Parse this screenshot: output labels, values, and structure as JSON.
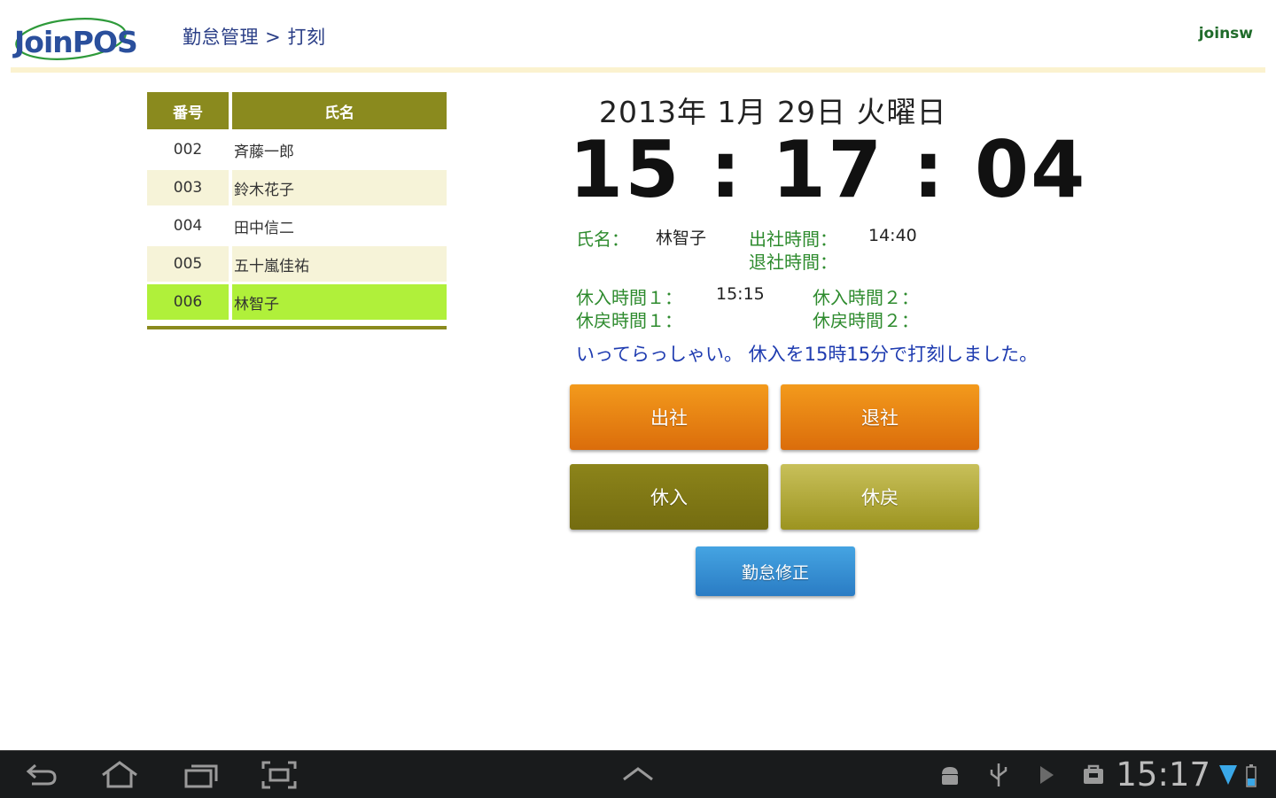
{
  "header": {
    "logo_text": "JoinPOS",
    "breadcrumb": "勤怠管理 > 打刻",
    "user": "joinsw"
  },
  "employee_table": {
    "columns": [
      "番号",
      "氏名"
    ],
    "rows": [
      {
        "id": "002",
        "name": "斉藤一郎"
      },
      {
        "id": "003",
        "name": "鈴木花子"
      },
      {
        "id": "004",
        "name": "田中信二"
      },
      {
        "id": "005",
        "name": "五十嵐佳祐"
      },
      {
        "id": "006",
        "name": "林智子",
        "selected": true
      }
    ]
  },
  "clock": {
    "date": "2013年 1月 29日 火曜日",
    "time": "15 : 17 : 04"
  },
  "detail": {
    "name_label": "氏名：",
    "name_value": "林智子",
    "clock_in_label": "出社時間：",
    "clock_in_value": "14:40",
    "clock_out_label": "退社時間：",
    "clock_out_value": "",
    "break_in1_label": "休入時間１：",
    "break_in1_value": "15:15",
    "break_out1_label": "休戻時間１：",
    "break_out1_value": "",
    "break_in2_label": "休入時間２：",
    "break_in2_value": "",
    "break_out2_label": "休戻時間２：",
    "break_out2_value": ""
  },
  "message": "いってらっしゃい。 休入を15時15分で打刻しました。",
  "buttons": {
    "clock_in": "出社",
    "clock_out": "退社",
    "break_in": "休入",
    "break_return": "休戻",
    "attendance_fix": "勤怠修正"
  },
  "system_bar": {
    "time": "15:17"
  },
  "colors": {
    "table_header": "#8a8a1e",
    "row_even": "#f6f3d8",
    "row_selected": "#b0f03a",
    "orange_button": "#e8820f",
    "olive_button": "#7d7515",
    "khaki_button": "#b0a83a",
    "blue_button": "#3590d4",
    "label_green": "#2e8b2e",
    "message_blue": "#1e3bb0"
  }
}
